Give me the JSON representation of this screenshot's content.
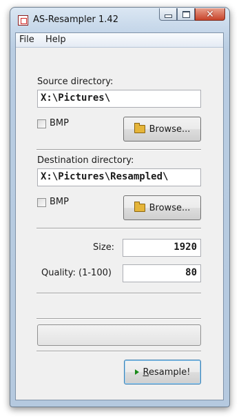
{
  "window": {
    "title": "AS-Resampler 1.42"
  },
  "menu": [
    "File",
    "Help"
  ],
  "source": {
    "label": "Source directory:",
    "path": "X:\\Pictures\\",
    "bmp_label": "BMP",
    "bmp_checked": false,
    "browse_label": "Browse..."
  },
  "destination": {
    "label": "Destination directory:",
    "path": "X:\\Pictures\\Resampled\\",
    "bmp_label": "BMP",
    "bmp_checked": false,
    "browse_label": "Browse..."
  },
  "size": {
    "label": "Size:",
    "value": "1920"
  },
  "quality": {
    "label": "Quality: (1-100)",
    "value": "80"
  },
  "progress": {
    "value": 0
  },
  "resample": {
    "label_first": "R",
    "label_rest": "esample!"
  },
  "colors": {
    "accent": "#3c7fb1",
    "close_button": "#c7432a"
  }
}
